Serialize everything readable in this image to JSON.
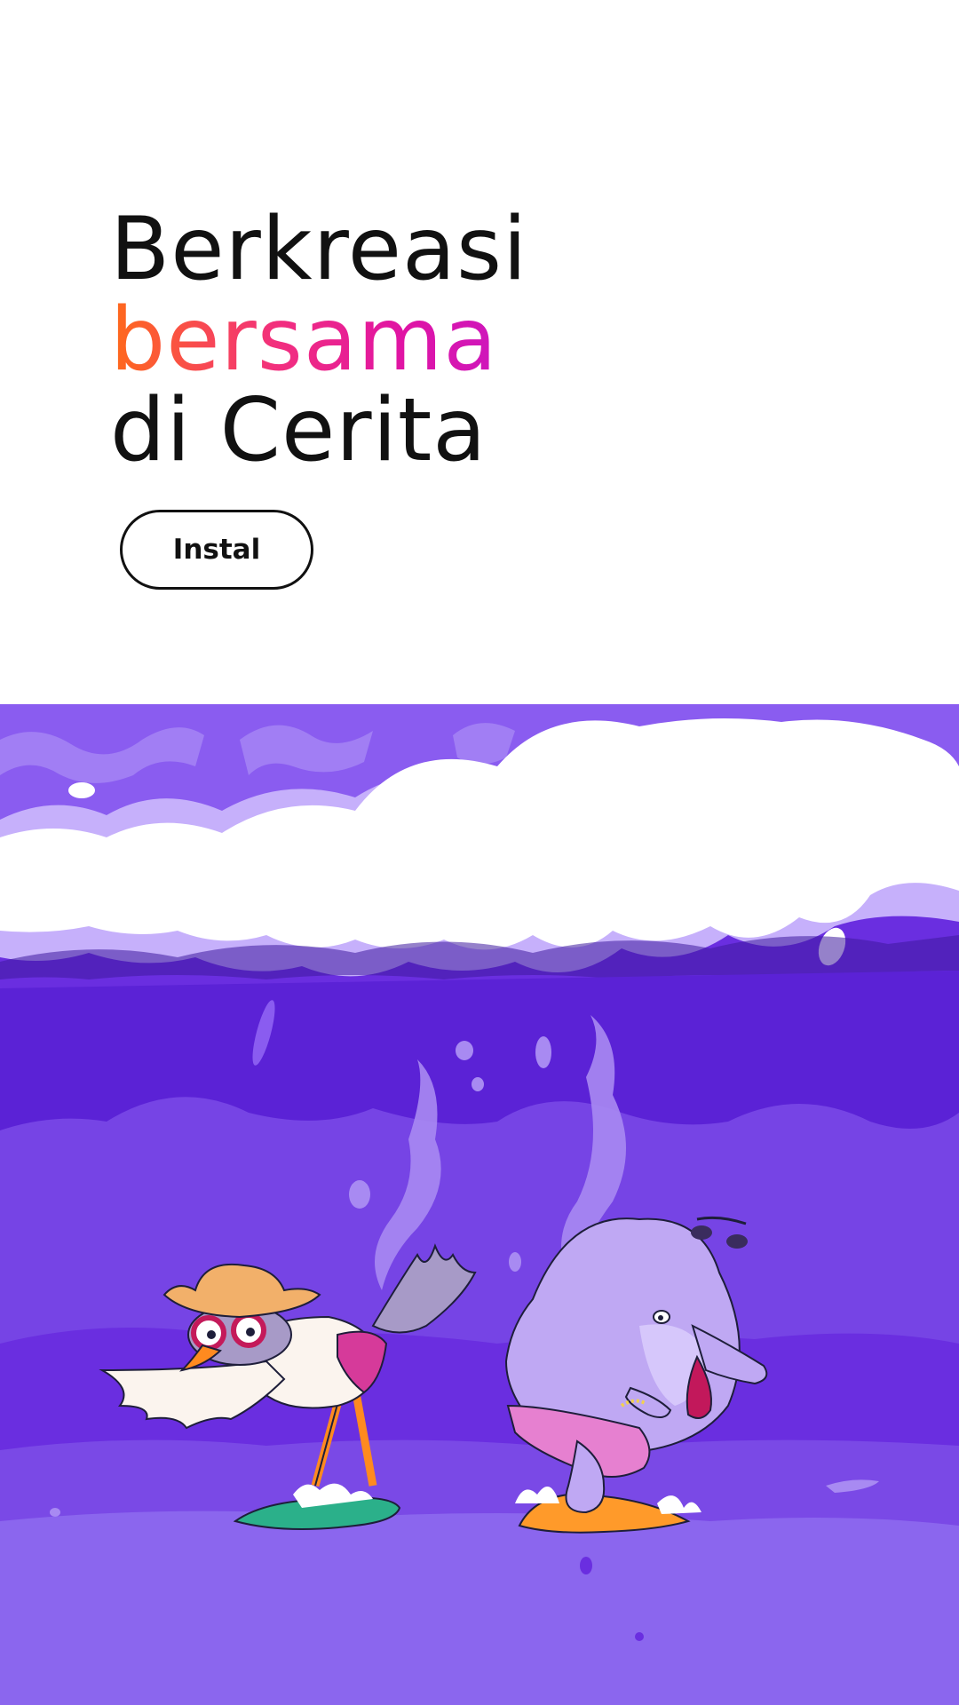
{
  "hero": {
    "line1": "Berkreasi",
    "line2": "bersama",
    "line3": "di Cerita"
  },
  "cta": {
    "label": "Instal"
  },
  "colors": {
    "gradient": [
      "#ff6a1a",
      "#f22f7e",
      "#e014a4",
      "#c818c4"
    ],
    "sky": "#7d4fe6",
    "wave": "#6a2ee0",
    "water": "#8b66ee"
  }
}
